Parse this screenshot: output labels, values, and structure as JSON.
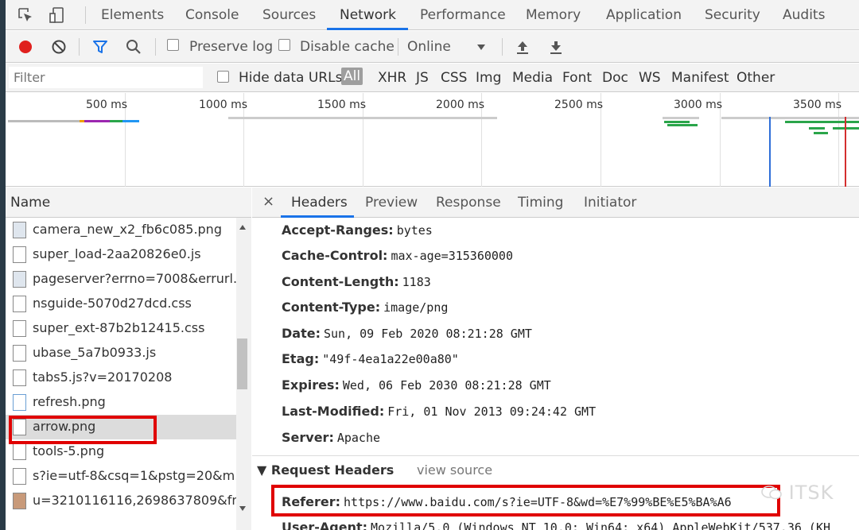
{
  "top_tabs": [
    "Elements",
    "Console",
    "Sources",
    "Network",
    "Performance",
    "Memory",
    "Application",
    "Security",
    "Audits"
  ],
  "active_tab": "Network",
  "toolbar": {
    "preserve_log": "Preserve log",
    "disable_cache": "Disable cache",
    "throttle": "Online"
  },
  "filter": {
    "placeholder": "Filter",
    "hide_data_urls": "Hide data URLs",
    "types": [
      "All",
      "XHR",
      "JS",
      "CSS",
      "Img",
      "Media",
      "Font",
      "Doc",
      "WS",
      "Manifest",
      "Other"
    ]
  },
  "overview": {
    "ticks": [
      "500 ms",
      "1000 ms",
      "1500 ms",
      "2000 ms",
      "2500 ms",
      "3000 ms",
      "3500 ms"
    ]
  },
  "name_pane": {
    "header": "Name",
    "rows": [
      "camera_new_x2_fb6c085.png",
      "super_load-2aa20826e0.js",
      "pageserver?errno=7008&errurl...",
      "nsguide-5070d27dcd.css",
      "super_ext-87b2b12415.css",
      "ubase_5a7b0933.js",
      "tabs5.js?v=20170208",
      "refresh.png",
      "arrow.png",
      "tools-5.png",
      "s?ie=utf-8&csq=1&pstg=20&m...",
      "u=3210116116,2698637809&fm..."
    ]
  },
  "detail": {
    "close": "×",
    "tabs": [
      "Headers",
      "Preview",
      "Response",
      "Timing",
      "Initiator"
    ],
    "response_headers": [
      {
        "k": "Accept-Ranges:",
        "v": "bytes"
      },
      {
        "k": "Cache-Control:",
        "v": "max-age=315360000"
      },
      {
        "k": "Content-Length:",
        "v": "1183"
      },
      {
        "k": "Content-Type:",
        "v": "image/png"
      },
      {
        "k": "Date:",
        "v": "Sun, 09 Feb 2020 08:21:28 GMT"
      },
      {
        "k": "Etag:",
        "v": "\"49f-4ea1a22e00a80\""
      },
      {
        "k": "Expires:",
        "v": "Wed, 06 Feb 2030 08:21:28 GMT"
      },
      {
        "k": "Last-Modified:",
        "v": "Fri, 01 Nov 2013 09:24:42 GMT"
      },
      {
        "k": "Server:",
        "v": "Apache"
      }
    ],
    "request_section": {
      "title": "▼ Request Headers",
      "link": "view source"
    },
    "request_headers": [
      {
        "k": "Referer:",
        "v": "https://www.baidu.com/s?ie=UTF-8&wd=%E7%99%BE%E5%BA%A6"
      },
      {
        "k": "User-Agent:",
        "v": "Mozilla/5.0 (Windows NT 10.0; Win64; x64) AppleWebKit/537.36 (KH"
      }
    ]
  },
  "watermark": "ITSK",
  "colors": {
    "accent": "#1a73e8",
    "record": "#e0201e",
    "highlight": "#e00000"
  }
}
